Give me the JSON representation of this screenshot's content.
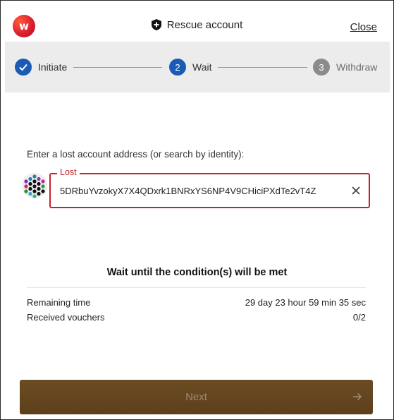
{
  "header": {
    "logo_text": "w",
    "title": "Rescue account",
    "close_label": "Close"
  },
  "stepper": {
    "steps": [
      {
        "label": "Initiate",
        "state": "done",
        "number": ""
      },
      {
        "label": "Wait",
        "state": "active",
        "number": "2"
      },
      {
        "label": "Withdraw",
        "state": "pending",
        "number": "3"
      }
    ]
  },
  "lost_account": {
    "prompt": "Enter a lost account address (or search by identity):",
    "field_label": "Lost",
    "value": "5DRbuYvzokyX7X4QDxrk1BNRxYS6NP4V9CHiciPXdTe2vT4Z"
  },
  "status": {
    "title": "Wait until the condition(s) will be met",
    "rows": [
      {
        "label": "Remaining time",
        "value": "29 day 23 hour 59 min 35 sec"
      },
      {
        "label": "Received vouchers",
        "value": "0/2"
      }
    ]
  },
  "footer": {
    "next_label": "Next"
  },
  "colors": {
    "accent_blue": "#1c5bb5",
    "error_red": "#c8222a",
    "button_brown": "#5d3f1a"
  }
}
